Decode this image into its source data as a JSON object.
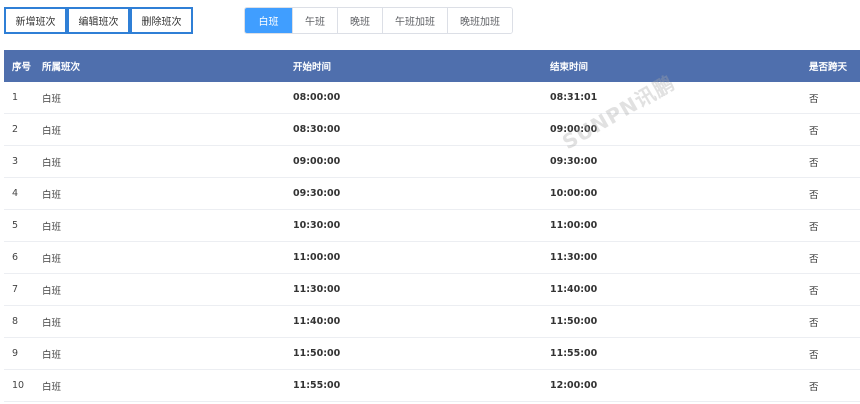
{
  "toolbar": {
    "add_label": "新增班次",
    "edit_label": "编辑班次",
    "delete_label": "删除班次"
  },
  "tabs": [
    {
      "label": "白班",
      "active": true
    },
    {
      "label": "午班",
      "active": false
    },
    {
      "label": "晚班",
      "active": false
    },
    {
      "label": "午班加班",
      "active": false
    },
    {
      "label": "晚班加班",
      "active": false
    }
  ],
  "table": {
    "headers": {
      "index": "序号",
      "shift": "所属班次",
      "start": "开始时间",
      "end": "结束时间",
      "cross_day": "是否跨天"
    },
    "rows": [
      {
        "index": "1",
        "shift": "白班",
        "start": "08:00:00",
        "end": "08:31:01",
        "cross_day": "否"
      },
      {
        "index": "2",
        "shift": "白班",
        "start": "08:30:00",
        "end": "09:00:00",
        "cross_day": "否"
      },
      {
        "index": "3",
        "shift": "白班",
        "start": "09:00:00",
        "end": "09:30:00",
        "cross_day": "否"
      },
      {
        "index": "4",
        "shift": "白班",
        "start": "09:30:00",
        "end": "10:00:00",
        "cross_day": "否"
      },
      {
        "index": "5",
        "shift": "白班",
        "start": "10:30:00",
        "end": "11:00:00",
        "cross_day": "否"
      },
      {
        "index": "6",
        "shift": "白班",
        "start": "11:00:00",
        "end": "11:30:00",
        "cross_day": "否"
      },
      {
        "index": "7",
        "shift": "白班",
        "start": "11:30:00",
        "end": "11:40:00",
        "cross_day": "否"
      },
      {
        "index": "8",
        "shift": "白班",
        "start": "11:40:00",
        "end": "11:50:00",
        "cross_day": "否"
      },
      {
        "index": "9",
        "shift": "白班",
        "start": "11:50:00",
        "end": "11:55:00",
        "cross_day": "否"
      },
      {
        "index": "10",
        "shift": "白班",
        "start": "11:55:00",
        "end": "12:00:00",
        "cross_day": "否"
      }
    ]
  },
  "watermark": {
    "text": "SUNPN讯鹏"
  },
  "colors": {
    "header_bg": "#4f6fad",
    "tab_active": "#409eff",
    "button_border": "#2f7fd6"
  }
}
